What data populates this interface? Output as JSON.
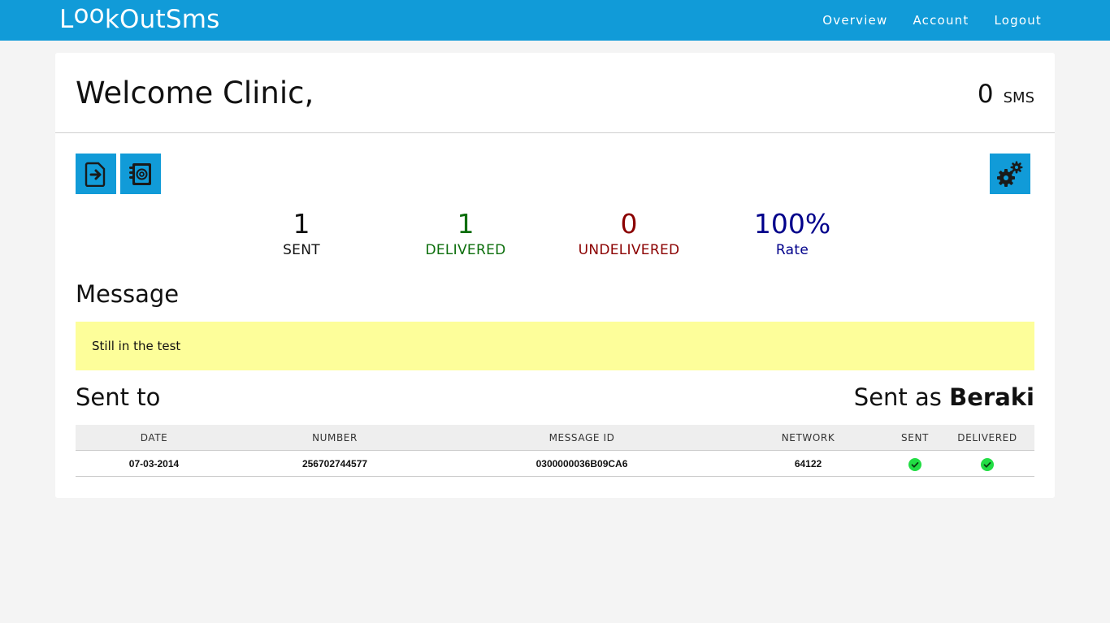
{
  "brand": {
    "letters": [
      "L",
      "o",
      "o",
      "k",
      "O",
      "u",
      "t",
      "S",
      "m",
      "s"
    ]
  },
  "nav": {
    "overview": "Overview",
    "account": "Account",
    "logout": "Logout"
  },
  "header": {
    "welcome": "Welcome Clinic,",
    "sms_count": "0",
    "sms_unit": "SMS"
  },
  "icons": {
    "send": "file-export-icon",
    "contacts": "address-book-icon",
    "settings": "gears-icon"
  },
  "stats": {
    "sent": {
      "value": "1",
      "label": "SENT"
    },
    "delivered": {
      "value": "1",
      "label": "DELIVERED"
    },
    "undelivered": {
      "value": "0",
      "label": "UNDELIVERED"
    },
    "rate": {
      "value": "100%",
      "label": "Rate"
    }
  },
  "message": {
    "heading": "Message",
    "text": "Still in the test"
  },
  "recipients": {
    "heading": "Sent to",
    "sent_as_prefix": "Sent as",
    "sender_name": "Beraki",
    "columns": [
      "DATE",
      "NUMBER",
      "MESSAGE ID",
      "NETWORK",
      "SENT",
      "DELIVERED"
    ],
    "rows": [
      {
        "date": "07-03-2014",
        "number": "256702744577",
        "message_id": "0300000036B09CA6",
        "network": "64122",
        "sent": true,
        "delivered": true
      }
    ]
  },
  "colors": {
    "accent": "#119bd8",
    "delivered": "#0b6e0b",
    "undelivered": "#8b0000",
    "rate": "#00008b",
    "message_bg": "#fdfe9a",
    "check": "#22dd44"
  }
}
